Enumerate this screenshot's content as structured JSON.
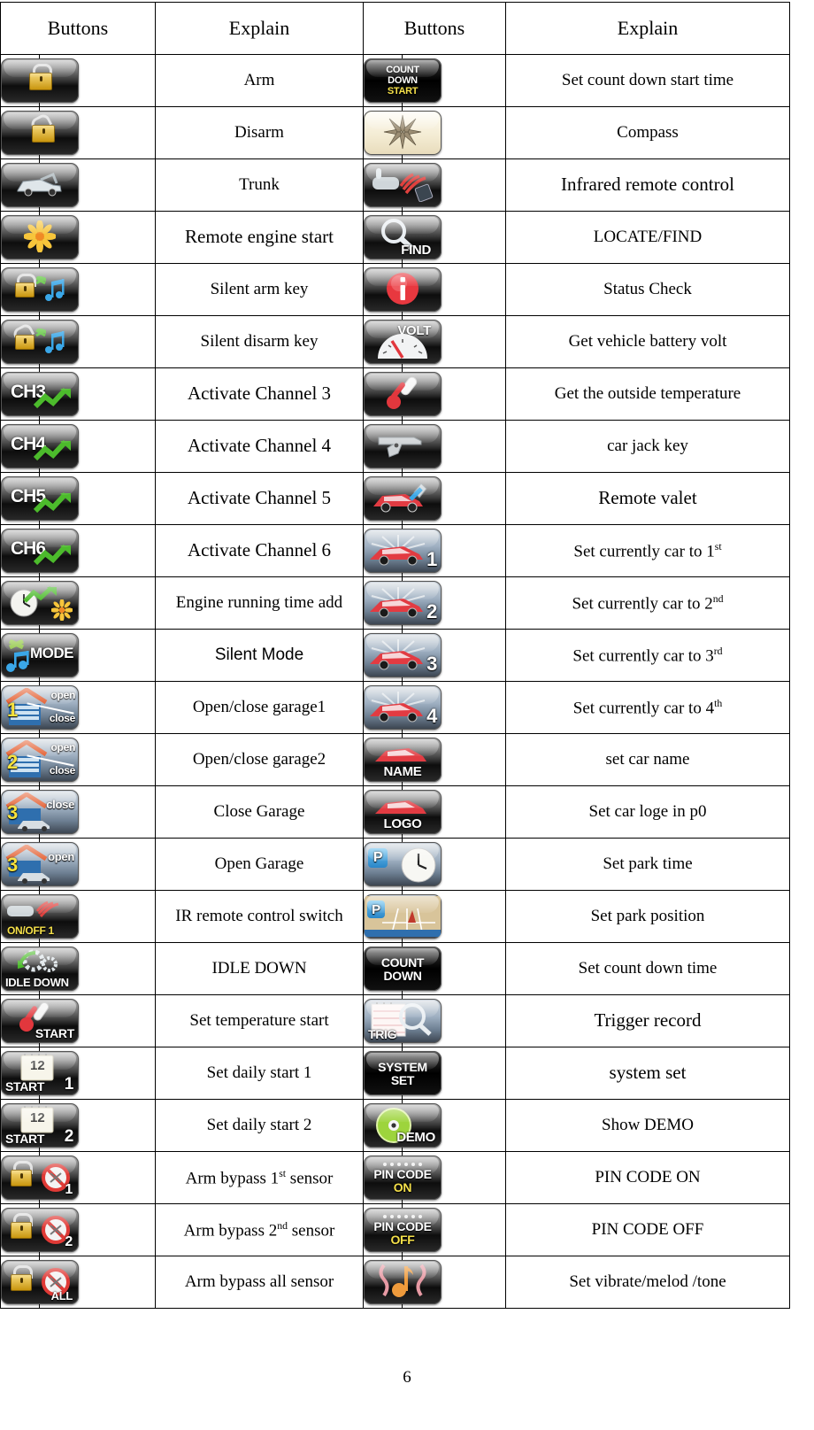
{
  "document": {
    "page_number": "6"
  },
  "table": {
    "headers": [
      "Buttons",
      "Explain",
      "Buttons",
      "Explain"
    ],
    "rows": [
      {
        "left": {
          "icon": "lock-closed-icon",
          "explain": "Arm"
        },
        "right": {
          "icon": "count-down-start-icon",
          "explain": "Set count down start time"
        }
      },
      {
        "left": {
          "icon": "lock-open-icon",
          "explain": "Disarm"
        },
        "right": {
          "icon": "compass-icon",
          "explain": "Compass"
        }
      },
      {
        "left": {
          "icon": "car-trunk-icon",
          "explain": "Trunk"
        },
        "right": {
          "icon": "infrared-remote-icon",
          "explain": "Infrared remote control"
        }
      },
      {
        "left": {
          "icon": "engine-start-flower-icon",
          "explain": "Remote engine start"
        },
        "right": {
          "icon": "locate-find-icon",
          "explain": "LOCATE/FIND"
        }
      },
      {
        "left": {
          "icon": "silent-arm-key-icon",
          "explain": "Silent arm key"
        },
        "right": {
          "icon": "status-info-icon",
          "explain": "Status Check"
        }
      },
      {
        "left": {
          "icon": "silent-disarm-key-icon",
          "explain": "Silent disarm key"
        },
        "right": {
          "icon": "volt-gauge-icon",
          "explain": "Get vehicle battery volt"
        }
      },
      {
        "left": {
          "icon": "channel-3-icon",
          "explain": "Activate Channel 3"
        },
        "right": {
          "icon": "thermometer-icon",
          "explain": "Get the  outside temperature"
        }
      },
      {
        "left": {
          "icon": "channel-4-icon",
          "explain": "Activate Channel 4"
        },
        "right": {
          "icon": "handgun-icon",
          "explain": "car jack key"
        }
      },
      {
        "left": {
          "icon": "channel-5-icon",
          "explain": "Activate Channel 5"
        },
        "right": {
          "icon": "remote-valet-icon",
          "explain": "Remote valet"
        }
      },
      {
        "left": {
          "icon": "channel-6-icon",
          "explain": "Activate Channel 6"
        },
        "right": {
          "icon": "car-1-icon",
          "explain_html": "Set currently  car to 1<sup>st</sup>"
        }
      },
      {
        "left": {
          "icon": "engine-running-time-icon",
          "explain": "Engine running time add"
        },
        "right": {
          "icon": "car-2-icon",
          "explain_html": "Set currently  car to 2<sup>nd</sup>"
        }
      },
      {
        "left": {
          "icon": "silent-mode-icon",
          "explain": "Silent Mode"
        },
        "right": {
          "icon": "car-3-icon",
          "explain_html": "Set currently  car to 3<sup>rd</sup>"
        }
      },
      {
        "left": {
          "icon": "garage1-open-close-icon",
          "explain": "Open/close garage1"
        },
        "right": {
          "icon": "car-4-icon",
          "explain_html": "Set currently  car to 4<sup>th</sup>"
        }
      },
      {
        "left": {
          "icon": "garage2-open-close-icon",
          "explain": "Open/close garage2"
        },
        "right": {
          "icon": "car-name-icon",
          "explain": "set car name"
        }
      },
      {
        "left": {
          "icon": "garage3-close-icon",
          "explain": "Close Garage"
        },
        "right": {
          "icon": "car-logo-icon",
          "explain": "Set car loge in p0"
        }
      },
      {
        "left": {
          "icon": "garage3-open-icon",
          "explain": "Open Garage"
        },
        "right": {
          "icon": "park-time-icon",
          "explain": "Set park time"
        }
      },
      {
        "left": {
          "icon": "ir-onoff-1-icon",
          "explain": "IR remote control switch"
        },
        "right": {
          "icon": "park-position-icon",
          "explain": "Set park position"
        }
      },
      {
        "left": {
          "icon": "idle-down-icon",
          "explain": "IDLE DOWN"
        },
        "right": {
          "icon": "count-down-icon",
          "explain": "Set count down time"
        }
      },
      {
        "left": {
          "icon": "temperature-start-icon",
          "explain": "Set temperature start"
        },
        "right": {
          "icon": "trig-record-icon",
          "explain": "Trigger record"
        }
      },
      {
        "left": {
          "icon": "daily-start-1-icon",
          "explain": "Set daily start 1"
        },
        "right": {
          "icon": "system-set-icon",
          "explain": "system set"
        }
      },
      {
        "left": {
          "icon": "daily-start-2-icon",
          "explain": "Set daily start 2"
        },
        "right": {
          "icon": "demo-disc-icon",
          "explain": "Show DEMO"
        }
      },
      {
        "left": {
          "icon": "arm-bypass-1-icon",
          "explain_html": "Arm bypass 1<sup>st</sup> sensor"
        },
        "right": {
          "icon": "pin-code-on-icon",
          "explain": "PIN CODE ON"
        }
      },
      {
        "left": {
          "icon": "arm-bypass-2-icon",
          "explain_html": "Arm bypass 2<sup>nd</sup>  sensor"
        },
        "right": {
          "icon": "pin-code-off-icon",
          "explain": "PIN CODE OFF"
        }
      },
      {
        "left": {
          "icon": "arm-bypass-all-icon",
          "explain": "Arm bypass all sensor"
        },
        "right": {
          "icon": "vibrate-melody-tone-icon",
          "explain": "Set vibrate/melod /tone"
        }
      }
    ]
  },
  "icon_labels": {
    "count-down-start-icon": [
      "COUNT",
      "DOWN",
      "START"
    ],
    "count-down-icon": [
      "COUNT",
      "DOWN"
    ],
    "locate-find-icon": [
      "FIND"
    ],
    "volt-gauge-icon": [
      "VOLT"
    ],
    "channel-3-icon": [
      "CH3"
    ],
    "channel-4-icon": [
      "CH4"
    ],
    "channel-5-icon": [
      "CH5"
    ],
    "channel-6-icon": [
      "CH6"
    ],
    "silent-mode-icon": [
      "MODE"
    ],
    "garage1-open-close-icon": [
      "1",
      "open",
      "close"
    ],
    "garage2-open-close-icon": [
      "2",
      "open",
      "close"
    ],
    "garage3-close-icon": [
      "3",
      "close"
    ],
    "garage3-open-icon": [
      "3",
      "open"
    ],
    "ir-onoff-1-icon": [
      "ON/OFF 1"
    ],
    "idle-down-icon": [
      "IDLE DOWN"
    ],
    "temperature-start-icon": [
      "START"
    ],
    "daily-start-1-icon": [
      "12",
      "START",
      "1"
    ],
    "daily-start-2-icon": [
      "12",
      "START",
      "2"
    ],
    "car-name-icon": [
      "NAME"
    ],
    "car-logo-icon": [
      "LOGO"
    ],
    "trig-record-icon": [
      "TRIG"
    ],
    "system-set-icon": [
      "SYSTEM",
      "SET"
    ],
    "demo-disc-icon": [
      "DEMO"
    ],
    "pin-code-on-icon": [
      "PIN CODE",
      "ON"
    ],
    "pin-code-off-icon": [
      "PIN CODE",
      "OFF"
    ],
    "arm-bypass-1-icon": [
      "1"
    ],
    "arm-bypass-2-icon": [
      "2"
    ],
    "arm-bypass-all-icon": [
      "ALL"
    ],
    "car-1-icon": [
      "1"
    ],
    "car-2-icon": [
      "2"
    ],
    "car-3-icon": [
      "3"
    ],
    "car-4-icon": [
      "4"
    ],
    "park-time-icon": [
      "P"
    ],
    "park-position-icon": [
      "P"
    ]
  },
  "colors": {
    "border": "#000000",
    "background": "#ffffff",
    "text": "#000000",
    "icon_label": "#ffffff",
    "icon_label_yellow": "#f5e04a",
    "lock_gold": "#d6a41a",
    "car_red": "#e23b42",
    "green_arrow": "#4cbb2c",
    "music_blue": "#3aa7e8"
  }
}
